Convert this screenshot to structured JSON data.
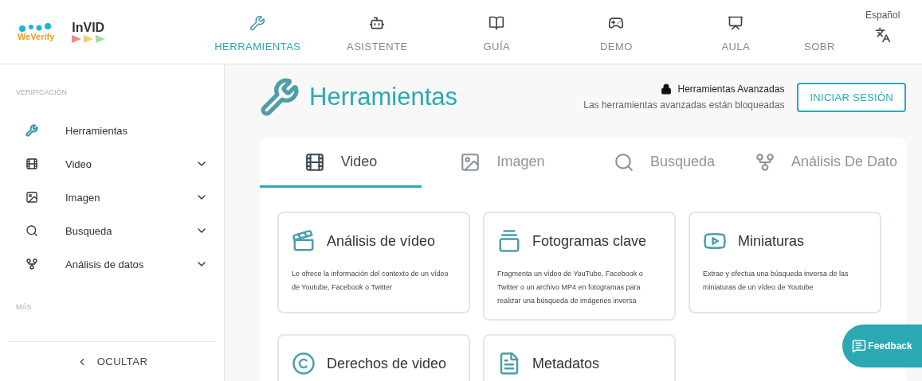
{
  "logo": {
    "weverify": "WeVerify",
    "invid": "InVID"
  },
  "nav": [
    {
      "label": "HERRAMIENTAS",
      "selected": true
    },
    {
      "label": "ASISTENTE",
      "selected": false
    },
    {
      "label": "GUÍA",
      "selected": false
    },
    {
      "label": "DEMO",
      "selected": false
    },
    {
      "label": "AULA",
      "selected": false
    },
    {
      "label": "SOBR",
      "selected": false
    }
  ],
  "language": "Español",
  "sidebar": {
    "sections": [
      {
        "title": "VERIFICACIÓN",
        "items": [
          {
            "label": "Herramientas",
            "selected": true,
            "expandable": false
          },
          {
            "label": "Video",
            "selected": false,
            "expandable": true
          },
          {
            "label": "Imagen",
            "selected": false,
            "expandable": true
          },
          {
            "label": "Busqueda",
            "selected": false,
            "expandable": true
          },
          {
            "label": "Análisis de datos",
            "selected": false,
            "expandable": true
          }
        ]
      },
      {
        "title": "MÁS"
      }
    ],
    "hide_button": "OCULTAR"
  },
  "page": {
    "title": "Herramientas",
    "advanced_title": "Herramientas Avanzadas",
    "advanced_note": "Las herramientas avanzadas están bloqueadas",
    "login_button": "INICIAR SESIÓN"
  },
  "tabs": [
    {
      "label": "Video",
      "selected": true
    },
    {
      "label": "Imagen",
      "selected": false
    },
    {
      "label": "Busqueda",
      "selected": false
    },
    {
      "label": "Análisis De Dato",
      "selected": false
    }
  ],
  "cards": [
    {
      "title": "Análisis de vídeo",
      "description": "Le ofrece la información del contexto de un vídeo de Youtube, Facebook o Twitter"
    },
    {
      "title": "Fotogramas clave",
      "description": "Fragmenta un vídeo de YouTube, Facebook o Twitter o un archivo MP4 en fotogramas para realizar una búsqueda de imágenes inversa"
    },
    {
      "title": "Miniaturas",
      "description": "Extrae y efectua una búsqueda inversa de las miniaturas de un vídeo de Youtube"
    },
    {
      "title": "Derechos de video"
    },
    {
      "title": "Metadatos"
    }
  ],
  "feedback_button": "Feedback"
}
